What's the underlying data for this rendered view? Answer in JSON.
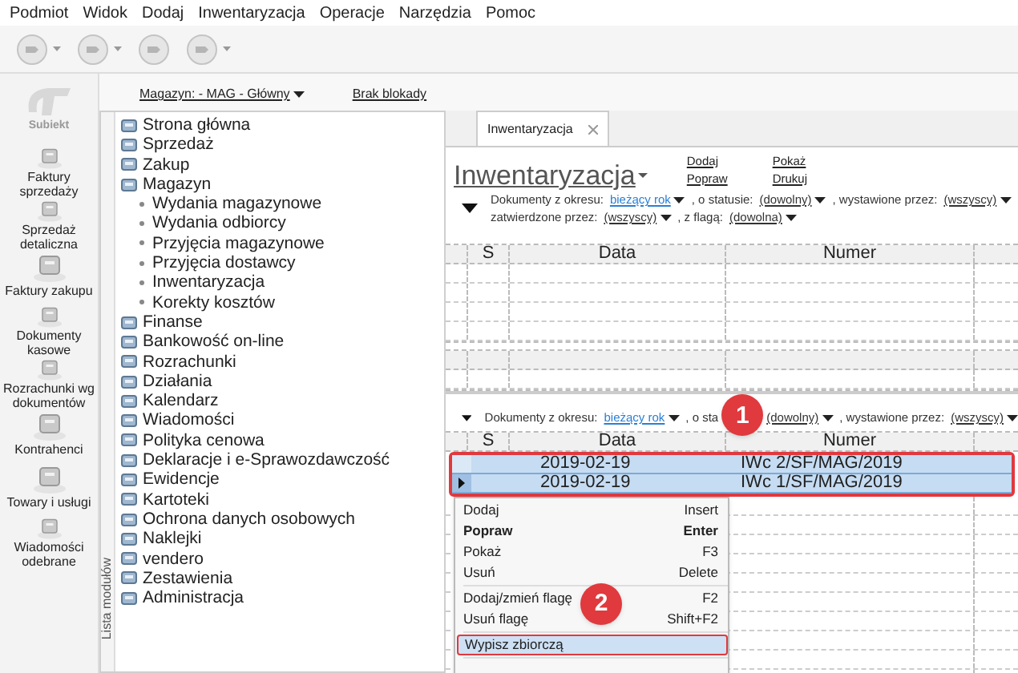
{
  "menu_bar": [
    "Podmiot",
    "Widok",
    "Dodaj",
    "Inwentaryzacja",
    "Operacje",
    "Narzędzia",
    "Pomoc"
  ],
  "sidebar": {
    "logo": "Subiekt",
    "items": [
      "Faktury sprzedaży",
      "Sprzedaż detaliczna",
      "Faktury zakupu",
      "Dokumenty kasowe",
      "Rozrachunki wg dokumentów",
      "Kontrahenci",
      "Towary i usługi",
      "Wiadomości odebrane"
    ]
  },
  "module_header": {
    "warehouse": "Magazyn: - MAG - Główny",
    "lock": "Brak blokady"
  },
  "module_list": {
    "label": "Lista modułów",
    "items": [
      {
        "label": "Strona główna"
      },
      {
        "label": "Sprzedaż"
      },
      {
        "label": "Zakup"
      },
      {
        "label": "Magazyn",
        "children": [
          {
            "label": "Wydania magazynowe"
          },
          {
            "label": "Wydania odbiorcy"
          },
          {
            "label": "Przyjęcia magazynowe"
          },
          {
            "label": "Przyjęcia dostawcy"
          },
          {
            "label": "Inwentaryzacja"
          },
          {
            "label": "Korekty kosztów"
          }
        ]
      },
      {
        "label": "Finanse"
      },
      {
        "label": "Bankowość on-line"
      },
      {
        "label": "Rozrachunki"
      },
      {
        "label": "Działania"
      },
      {
        "label": "Kalendarz"
      },
      {
        "label": "Wiadomości"
      },
      {
        "label": "Polityka cenowa"
      },
      {
        "label": "Deklaracje i e-Sprawozdawczość"
      },
      {
        "label": "Ewidencje"
      },
      {
        "label": "Kartoteki"
      },
      {
        "label": "Ochrona danych osobowych"
      },
      {
        "label": "Naklejki"
      },
      {
        "label": "vendero"
      },
      {
        "label": "Zestawienia"
      },
      {
        "label": "Administracja"
      }
    ]
  },
  "tab": {
    "label": "Inwentaryzacja"
  },
  "page": {
    "title": "Inwentaryzacja",
    "actions": [
      "Dodaj",
      "Popraw",
      "Pokaż",
      "Drukuj"
    ]
  },
  "filter_top": {
    "lines": [
      [
        {
          "kind": "text",
          "text": "Dokumenty z okresu:"
        },
        {
          "kind": "link",
          "text": "bieżący rok"
        },
        {
          "kind": "text",
          "text": ", o statusie:"
        },
        {
          "kind": "drop",
          "text": "(dowolny)"
        },
        {
          "kind": "text",
          "text": ", wystawione przez:"
        },
        {
          "kind": "drop",
          "text": "(wszyscy)"
        }
      ],
      [
        {
          "kind": "text",
          "text": "zatwierdzone przez:"
        },
        {
          "kind": "drop",
          "text": "(wszyscy)"
        },
        {
          "kind": "text",
          "text": ", z flagą:"
        },
        {
          "kind": "drop",
          "text": "(dowolna)"
        }
      ]
    ]
  },
  "table_top": {
    "columns": [
      "S",
      "Data",
      "Numer"
    ]
  },
  "filter_bottom": {
    "lines": [
      [
        {
          "kind": "text",
          "text": "Dokumenty z okresu:"
        },
        {
          "kind": "link",
          "text": "bieżący rok"
        },
        {
          "kind": "text",
          "text": ", o sta"
        },
        {
          "kind": "drop",
          "text": "(dowolny)"
        },
        {
          "kind": "text",
          "text": ", wystawione przez:"
        },
        {
          "kind": "drop",
          "text": "(wszyscy)"
        }
      ]
    ]
  },
  "table_bottom": {
    "columns": [
      "S",
      "Data",
      "Numer"
    ],
    "rows": [
      {
        "date": "2019-02-19",
        "number": "IWc 2/SF/MAG/2019",
        "selected": true,
        "current": false
      },
      {
        "date": "2019-02-19",
        "number": "IWc 1/SF/MAG/2019",
        "selected": true,
        "current": true
      }
    ]
  },
  "context_menu": [
    {
      "kind": "item",
      "label": "Dodaj",
      "shortcut": "Insert",
      "bold": false,
      "selected": false
    },
    {
      "kind": "item",
      "label": "Popraw",
      "shortcut": "Enter",
      "bold": true,
      "selected": false
    },
    {
      "kind": "item",
      "label": "Pokaż",
      "shortcut": "F3",
      "bold": false,
      "selected": false
    },
    {
      "kind": "item",
      "label": "Usuń",
      "shortcut": "Delete",
      "bold": false,
      "selected": false
    },
    {
      "kind": "separator"
    },
    {
      "kind": "item",
      "label": "Dodaj/zmień flagę",
      "shortcut": "F2",
      "bold": false,
      "selected": false
    },
    {
      "kind": "item",
      "label": "Usuń flagę",
      "shortcut": "Shift+F2",
      "bold": false,
      "selected": false
    },
    {
      "kind": "separator"
    },
    {
      "kind": "item",
      "label": "Wypisz zbiorczą",
      "bold": false,
      "selected": true
    },
    {
      "kind": "separator"
    }
  ],
  "annotations": [
    {
      "label": "1"
    },
    {
      "label": "2"
    }
  ]
}
